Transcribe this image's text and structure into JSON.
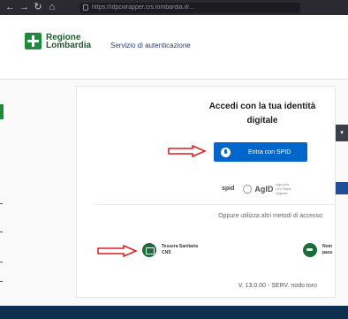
{
  "browser": {
    "url": "https://idpcwrapper.crs.lombardia.it/..."
  },
  "header": {
    "logo_line1": "Regione",
    "logo_line2": "Lombardia",
    "service_title": "Servizio di autenticazione"
  },
  "card": {
    "title": "Accedi con la tua identità digitale",
    "spid_button_label": "Entra con SPID",
    "spid_logo": "spid",
    "agid_logo": "AgID",
    "agid_subtext": "Agenzia per l'Italia Digitale",
    "alt_methods_text": "Oppure utilizza altri metodi di accesso",
    "method_cns_line1": "Tessera Sanitaria",
    "method_cns_line2": "CNS",
    "method_other_line1": "Nom",
    "method_other_line2": "pass",
    "version": "V. 13.0.00 - SERV. nodo toro"
  },
  "colors": {
    "spid_blue": "#0066cc",
    "lombardia_green": "#1d8a3e",
    "arrow_red": "#e01b1b",
    "footer": "#0e2f4f"
  }
}
